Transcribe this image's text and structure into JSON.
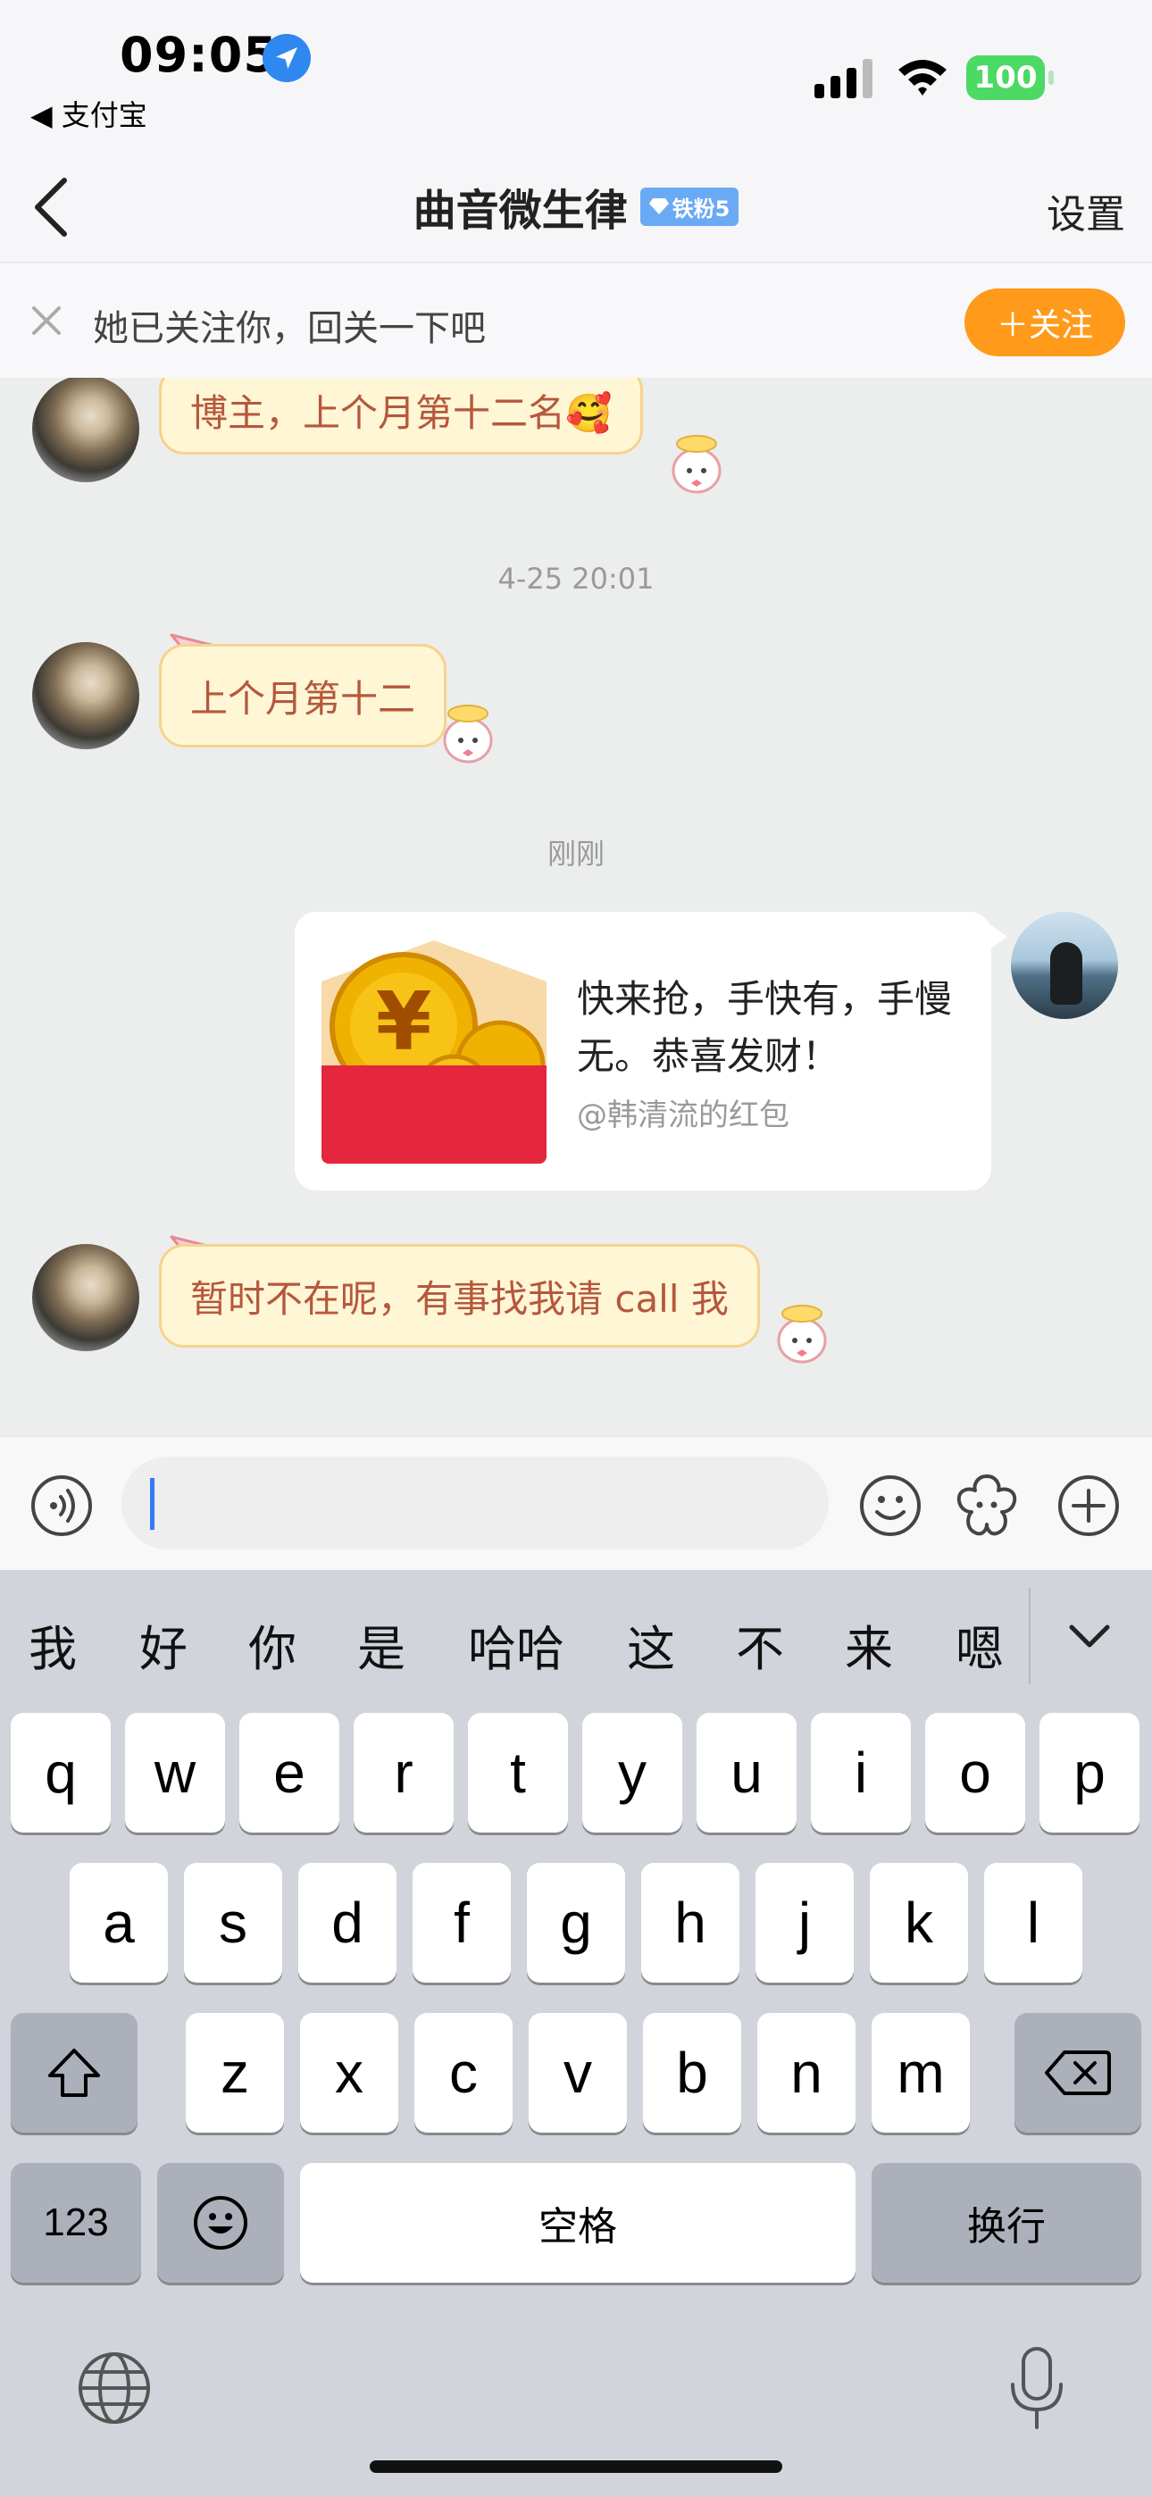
{
  "status_bar": {
    "time": "09:05",
    "back_app": "◀ 支付宝",
    "battery": "100"
  },
  "nav": {
    "title": "曲音微生律",
    "badge": "铁粉5",
    "settings": "设置"
  },
  "follow_banner": {
    "text": "她已关注你，回关一下吧",
    "button": "＋关注"
  },
  "messages": [
    {
      "type": "bubble",
      "sender": "other",
      "text": "博主，上个月第十二名🥰"
    },
    {
      "type": "timestamp",
      "text": "4-25 20:01"
    },
    {
      "type": "bubble",
      "sender": "other",
      "text": "上个月第十二"
    },
    {
      "type": "timestamp",
      "text": "刚刚"
    },
    {
      "type": "hongbao",
      "sender": "self",
      "text": "快来抢，手快有，手慢无。恭喜发财！",
      "sub": "@韩清流的红包"
    },
    {
      "type": "bubble",
      "sender": "other",
      "text": "暂时不在呢，有事找我请 call 我"
    }
  ],
  "input": {
    "value": ""
  },
  "keyboard": {
    "candidates": [
      "我",
      "好",
      "你",
      "是",
      "哈哈",
      "这",
      "不",
      "来",
      "嗯"
    ],
    "row1": [
      "q",
      "w",
      "e",
      "r",
      "t",
      "y",
      "u",
      "i",
      "o",
      "p"
    ],
    "row2": [
      "a",
      "s",
      "d",
      "f",
      "g",
      "h",
      "j",
      "k",
      "l"
    ],
    "row3": [
      "z",
      "x",
      "c",
      "v",
      "b",
      "n",
      "m"
    ],
    "numbers_key": "123",
    "space_key": "空格",
    "return_key": "换行"
  },
  "colors": {
    "bubble_bg": "#fff6d6",
    "bubble_border": "#f4d48e",
    "bubble_text": "#b5583c",
    "follow_button": "#ff9a1a",
    "fan_badge": "#6aa9f4",
    "hongbao_red": "#e5263f",
    "battery_green": "#4cd964"
  },
  "icons": {
    "location": "location-arrow-icon",
    "signal": "cellular-signal-icon",
    "wifi": "wifi-icon",
    "back": "chevron-left-icon",
    "close": "close-icon",
    "voice": "voice-icon",
    "emoji": "emoji-icon",
    "sticker": "sticker-icon",
    "plus": "plus-icon",
    "collapse": "chevron-down-icon",
    "shift": "shift-icon",
    "delete": "delete-icon",
    "globe": "globe-icon",
    "microphone": "microphone-icon"
  }
}
